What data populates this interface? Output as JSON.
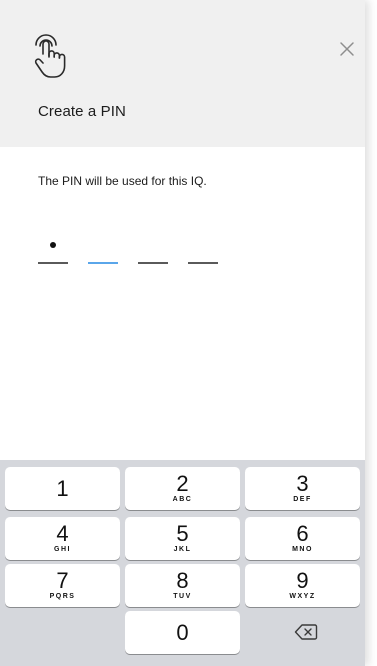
{
  "header": {
    "title": "Create a PIN",
    "touch_icon": "tap-finger-icon",
    "close_icon": "close-icon",
    "background": "#f0f0f0"
  },
  "body": {
    "instruction": "The PIN will be used for this IQ."
  },
  "pin": {
    "length": 4,
    "entered_count": 1,
    "active_index": 1,
    "active_color": "#5aa6ea",
    "inactive_color": "#5a5a5a"
  },
  "keypad": {
    "background": "#d5d7dc",
    "keys": [
      {
        "digit": "1",
        "letters": ""
      },
      {
        "digit": "2",
        "letters": "ABC"
      },
      {
        "digit": "3",
        "letters": "DEF"
      },
      {
        "digit": "4",
        "letters": "GHI"
      },
      {
        "digit": "5",
        "letters": "JKL"
      },
      {
        "digit": "6",
        "letters": "MNO"
      },
      {
        "digit": "7",
        "letters": "PQRS"
      },
      {
        "digit": "8",
        "letters": "TUV"
      },
      {
        "digit": "9",
        "letters": "WXYZ"
      },
      {
        "digit": "0",
        "letters": ""
      }
    ],
    "delete_icon": "backspace-icon"
  }
}
